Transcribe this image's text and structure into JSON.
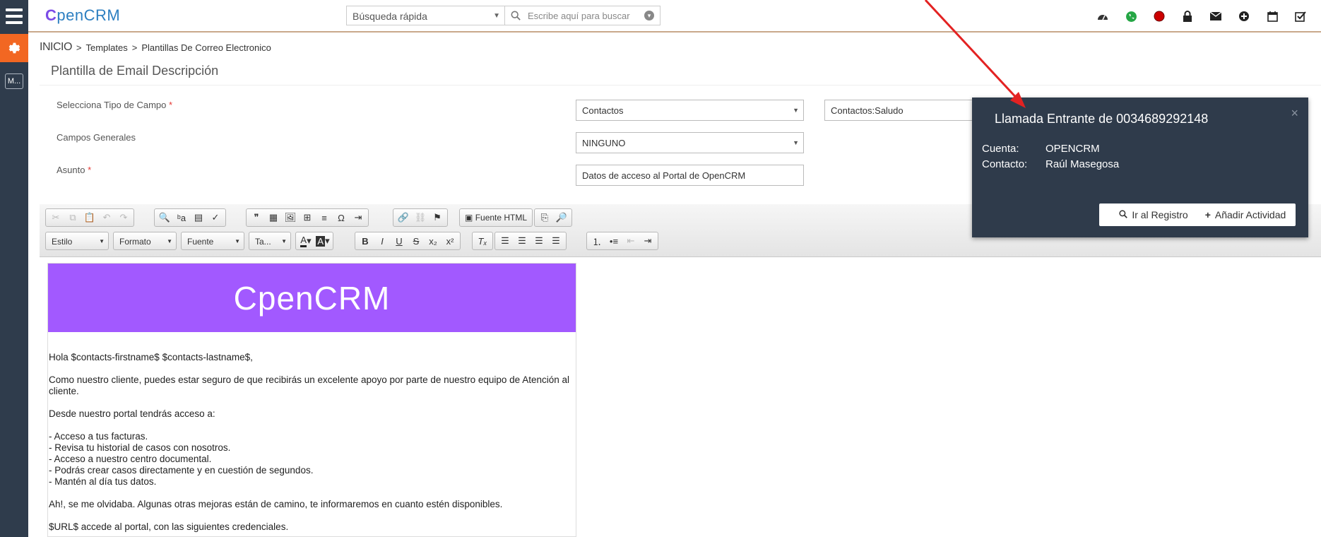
{
  "app": {
    "logo_text": "penCRM",
    "logo_letter": "C",
    "module_short": "M..."
  },
  "header": {
    "quick_search_label": "Búsqueda rápida",
    "search_placeholder": "Escribe aquí para buscar"
  },
  "breadcrumb": {
    "home": "INICIO",
    "items": [
      "Templates",
      "Plantillas De Correo Electronico"
    ],
    "sep": ">"
  },
  "form": {
    "title": "Plantilla de Email Descripción",
    "field_type_label": "Selecciona Tipo de Campo",
    "field_type_value": "Contactos",
    "field_type_sub_value": "Contactos:Saludo",
    "general_label": "Campos Generales",
    "general_value": "NINGUNO",
    "subject_label": "Asunto",
    "subject_value": "Datos de acceso al Portal de OpenCRM",
    "required_mark": "*"
  },
  "editor": {
    "source_label": "Fuente HTML",
    "combo_style": "Estilo",
    "combo_format": "Formato",
    "combo_font": "Fuente",
    "combo_size": "Ta...",
    "banner_logo": "penCRM",
    "banner_letter": "C",
    "body": {
      "greeting": "Hola $contacts-firstname$ $contacts-lastname$,",
      "p1": "Como nuestro cliente, puedes estar seguro de que recibirás un excelente apoyo por parte de nuestro equipo de Atención al cliente.",
      "p2": "Desde nuestro portal tendrás acceso a:",
      "list": [
        "- Acceso a tus facturas.",
        "- Revisa tu historial de casos con nosotros.",
        "- Acceso a nuestro centro documental.",
        "- Podrás crear casos directamente y en cuestión de segundos.",
        "- Mantén al día tus datos."
      ],
      "p3": "Ah!, se me olvidaba. Algunas otras mejoras están de camino, te informaremos en cuanto estén disponibles.",
      "p4": "$URL$ accede al portal, con las siguientes credenciales."
    }
  },
  "popup": {
    "title": "Llamada Entrante de 0034689292148",
    "close": "×",
    "account_label": "Cuenta:",
    "account_value": "OPENCRM",
    "contact_label": "Contacto:",
    "contact_value": "Raúl Masegosa",
    "go_button": "Ir al Registro",
    "add_button": "Añadir Actividad"
  },
  "colors": {
    "rail": "#2f3c4c",
    "accent_orange": "#f26722",
    "banner_purple": "#a259ff",
    "popup_bg": "#2f3b4b",
    "arrow_red": "#e32222"
  }
}
